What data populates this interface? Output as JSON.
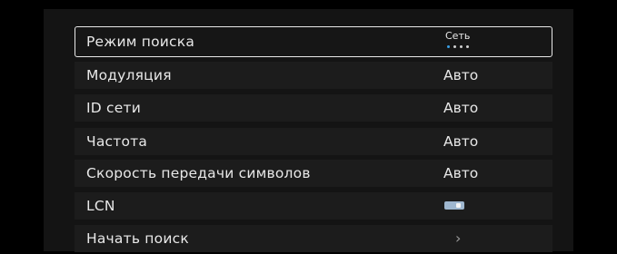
{
  "menu": {
    "search_mode": {
      "label": "Режим поиска",
      "value": "Сеть",
      "option_count": 4,
      "selected_index": 0
    },
    "modulation": {
      "label": "Модуляция",
      "value": "Авто"
    },
    "network_id": {
      "label": "ID сети",
      "value": "Авто"
    },
    "frequency": {
      "label": "Частота",
      "value": "Авто"
    },
    "symbol_rate": {
      "label": "Скорость передачи символов",
      "value": "Авто"
    },
    "lcn": {
      "label": "LCN",
      "toggle_state": "on"
    },
    "start_search": {
      "label": "Начать поиск",
      "icon": "chevron-right-icon"
    }
  },
  "colors": {
    "background": "#000000",
    "panel": "#141414",
    "row": "#1c1c1c",
    "text": "#e8e8e8",
    "accent_dot": "#3aa0e6",
    "toggle": "#9fb7cf"
  }
}
